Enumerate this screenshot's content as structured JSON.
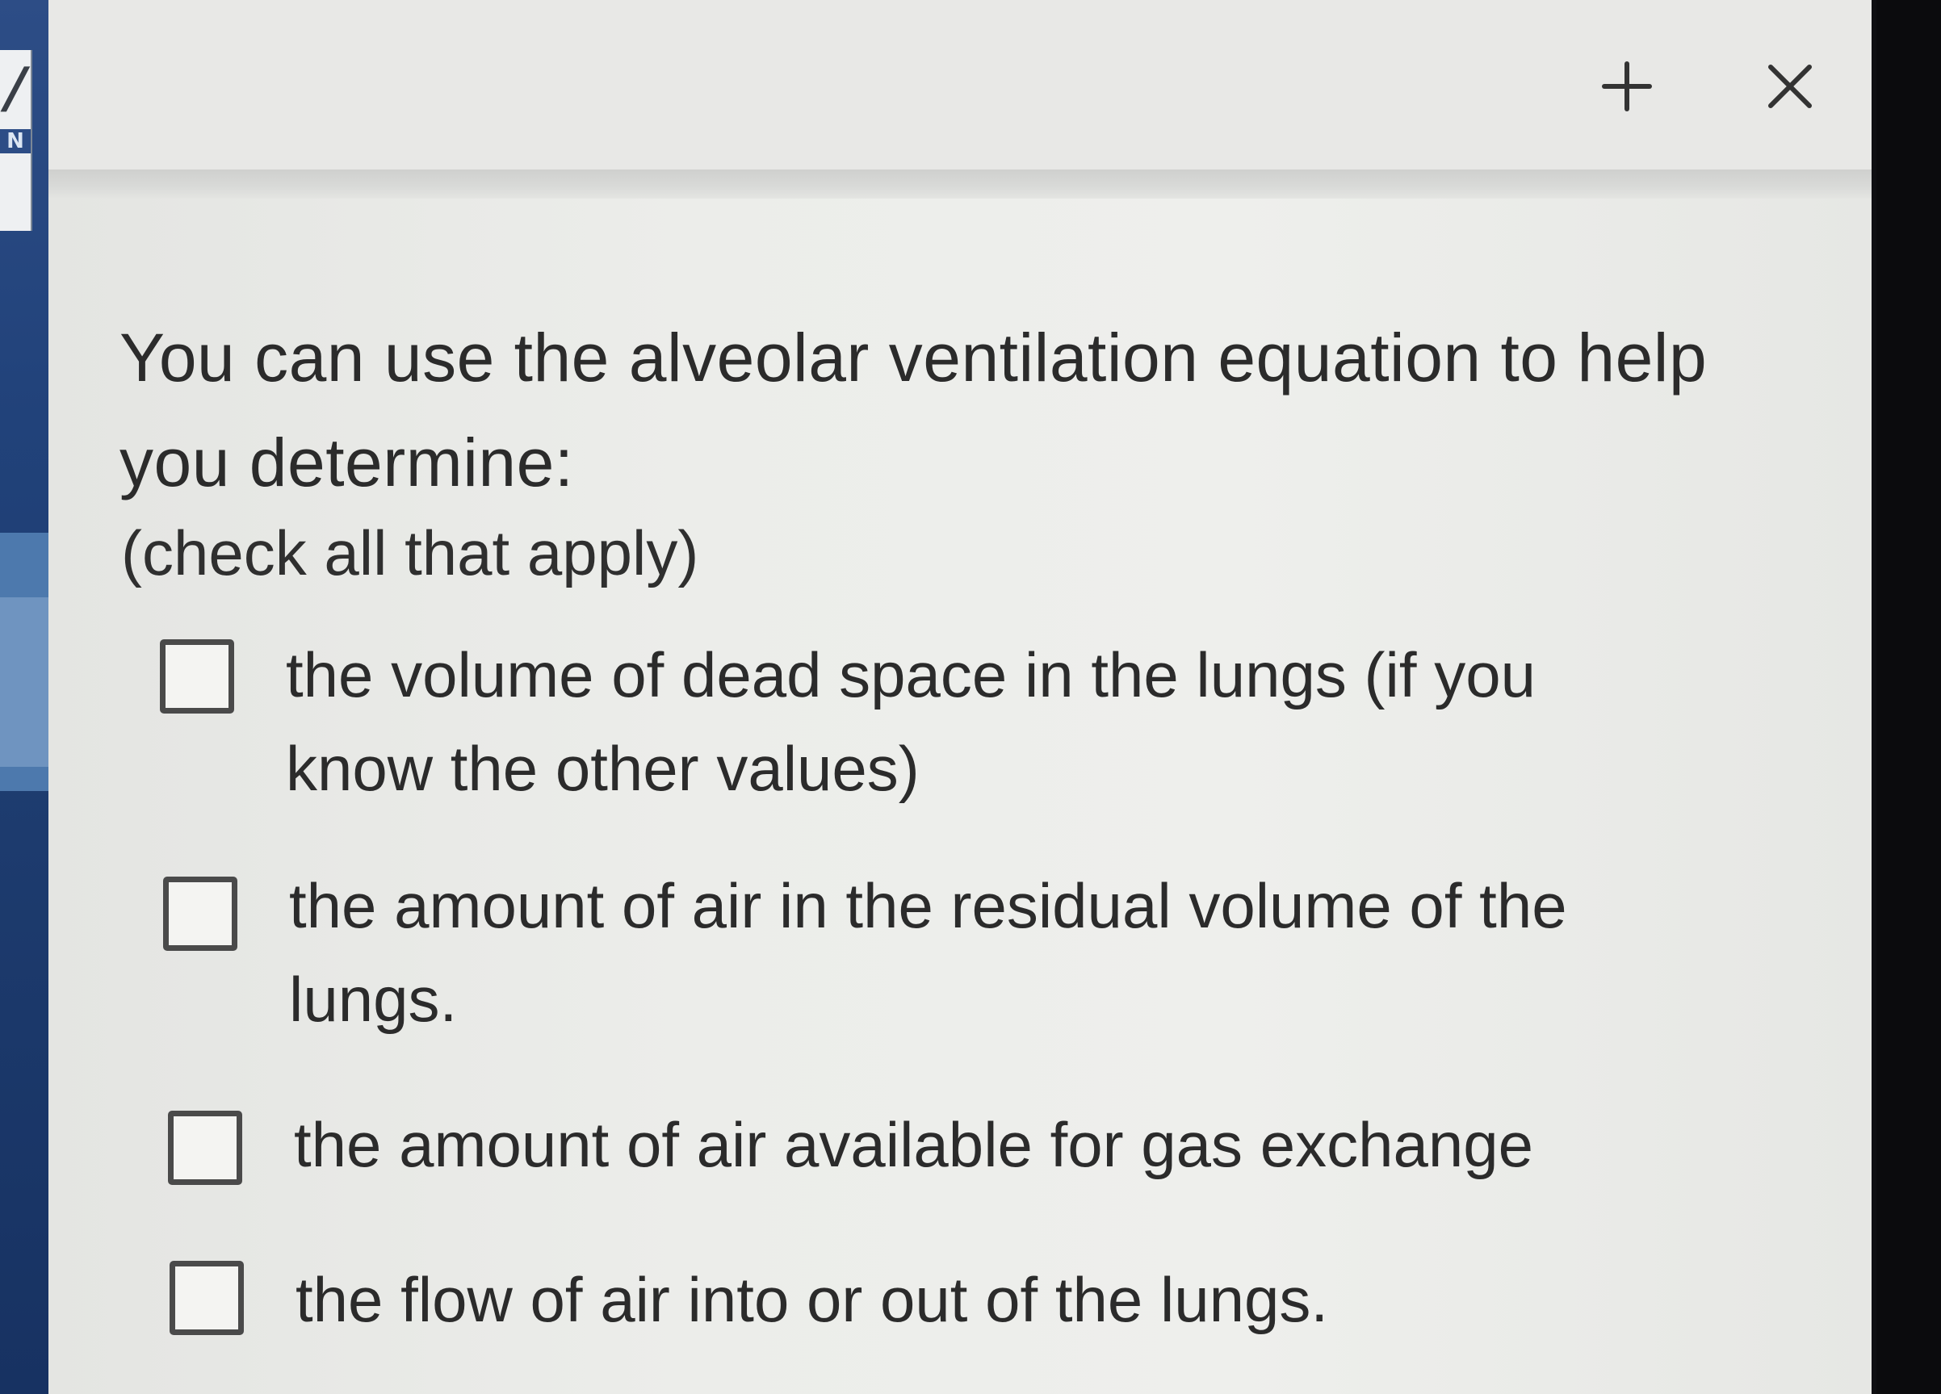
{
  "header": {
    "add_icon": "plus-icon",
    "close_icon": "close-icon"
  },
  "question": {
    "text": "You can use the alveolar ventilation equation to help you determine:",
    "instruction": "(check all that apply)"
  },
  "options": [
    {
      "label": "the volume of dead space in the lungs (if you know the other values)",
      "checked": false
    },
    {
      "label": "the amount of air in the residual volume of the lungs.",
      "checked": false
    },
    {
      "label": "the amount of air available for gas exchange",
      "checked": false
    },
    {
      "label": "the flow of air into or out of the lungs.",
      "checked": false
    }
  ],
  "colors": {
    "panel_bg": "#ecedea",
    "text": "#2b2b2b",
    "checkbox_border": "#4a4a4a",
    "left_sidebar": "#21427a"
  }
}
